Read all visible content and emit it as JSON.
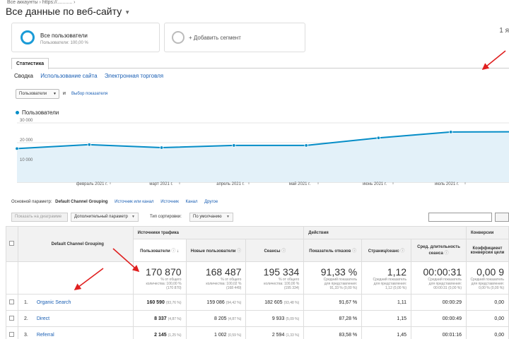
{
  "breadcrumb": "Все аккаунты › https://........... ›",
  "title": "Все данные по веб-сайту",
  "date_range": "1 я",
  "segments": {
    "active_label": "Все пользователи",
    "active_sub": "Пользователи: 100,00 %",
    "add_label": "+ Добавить сегмент"
  },
  "tabs": {
    "active": "Статистика"
  },
  "subtabs": [
    "Сводка",
    "Использование сайта",
    "Электронная торговля"
  ],
  "metric_selector": {
    "value": "Пользователи",
    "and_label": "и",
    "pick_label": "Выбор показателя"
  },
  "chart_data": {
    "type": "line",
    "series": [
      {
        "name": "Пользователи",
        "values": [
          17000,
          19000,
          17500,
          18600,
          18600,
          22400,
          25400,
          25500
        ]
      }
    ],
    "x_ticks": [
      "февраль 2021 г.",
      "март 2021 г.",
      "апрель 2021 г.",
      "май 2021 г.",
      "июнь 2021 г.",
      "июль 2021 г."
    ],
    "y_ticks": [
      "30 000",
      "20 000",
      "10 000"
    ],
    "ylim": [
      0,
      30000
    ],
    "grid": true,
    "color": "#058dc7"
  },
  "dimension_bar": {
    "label": "Основной параметр:",
    "current": "Default Channel Grouping",
    "links": [
      "Источник или канал",
      "Источник",
      "Канал",
      "Другое"
    ]
  },
  "toolbar": {
    "plot_button": "Показать на диаграмме",
    "secondary_dimension": "Дополнительный параметр",
    "sort_label": "Тип сортировки:",
    "sort_value": "По умолчанию"
  },
  "table": {
    "dimension_header": "Default Channel Grouping",
    "groups": [
      "Источники трафика",
      "Действия",
      "Конверсии"
    ],
    "columns": [
      "Пользователи",
      "Новые пользователи",
      "Сеансы",
      "Показатель отказов",
      "Страниц/сеанс",
      "Сред. длительность сеанса",
      "Коэффициент конверсии цели"
    ],
    "totals": [
      {
        "value": "170 870",
        "sub1": "% от общего",
        "sub2": "количества: 100,00 %",
        "sub3": "(170 870)"
      },
      {
        "value": "168 487",
        "sub1": "% от общего",
        "sub2": "количества: 100,02 %",
        "sub3": "(168 449)"
      },
      {
        "value": "195 334",
        "sub1": "% от общего",
        "sub2": "количества: 100,00 %",
        "sub3": "(195 334)"
      },
      {
        "value": "91,33 %",
        "sub1": "Средний показатель",
        "sub2": "для представления:",
        "sub3": "91,33 % (0,00 %)"
      },
      {
        "value": "1,12",
        "sub1": "Средний показатель",
        "sub2": "для представления:",
        "sub3": "1,12 (0,00 %)"
      },
      {
        "value": "00:00:31",
        "sub1": "Средний показатель",
        "sub2": "для представления:",
        "sub3": "00:00:31 (0,00 %)"
      },
      {
        "value": "0,00 9",
        "sub1": "Средний показатель",
        "sub2": "для представления:",
        "sub3": "0,00 % (0,00 %)"
      }
    ],
    "rows": [
      {
        "num": "1.",
        "channel": "Organic Search",
        "users": "160 590",
        "users_pct": "(93,76 %)",
        "new_users": "159 086",
        "new_pct": "(94,42 %)",
        "sessions": "182 605",
        "sess_pct": "(93,48 %)",
        "bounce": "91,67 %",
        "pages": "1,11",
        "duration": "00:00:29",
        "conv": "0,00"
      },
      {
        "num": "2.",
        "channel": "Direct",
        "users": "8 337",
        "users_pct": "(4,87 %)",
        "new_users": "8 205",
        "new_pct": "(4,87 %)",
        "sessions": "9 933",
        "sess_pct": "(5,09 %)",
        "bounce": "87,28 %",
        "pages": "1,15",
        "duration": "00:00:49",
        "conv": "0,00"
      },
      {
        "num": "3.",
        "channel": "Referral",
        "users": "2 145",
        "users_pct": "(1,25 %)",
        "new_users": "1 002",
        "new_pct": "(0,59 %)",
        "sessions": "2 594",
        "sess_pct": "(1,33 %)",
        "bounce": "83,58 %",
        "pages": "1,45",
        "duration": "00:01:16",
        "conv": "0,00"
      }
    ]
  }
}
